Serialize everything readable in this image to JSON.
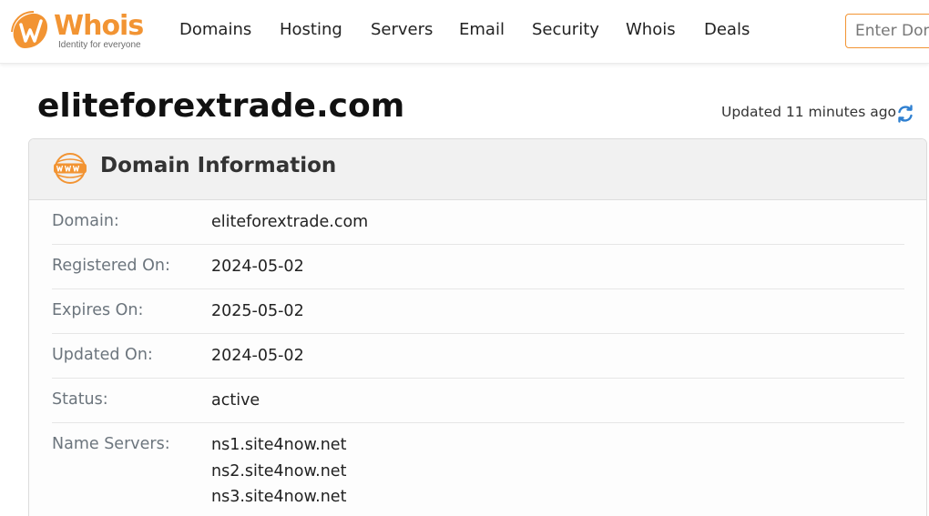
{
  "header": {
    "logo_text": "Whois",
    "logo_tagline": "Identity for everyone",
    "nav": [
      {
        "label": "Domains"
      },
      {
        "label": "Hosting"
      },
      {
        "label": "Servers"
      },
      {
        "label": "Email"
      },
      {
        "label": "Security"
      },
      {
        "label": "Whois"
      },
      {
        "label": "Deals"
      }
    ],
    "search_placeholder": "Enter Domain or IP"
  },
  "page": {
    "title": "eliteforextrade.com",
    "updated_text": "Updated 11 minutes ago"
  },
  "domain_info": {
    "title": "Domain Information",
    "rows": [
      {
        "label": "Domain:",
        "value": "eliteforextrade.com"
      },
      {
        "label": "Registered On:",
        "value": "2024-05-02"
      },
      {
        "label": "Expires On:",
        "value": "2025-05-02"
      },
      {
        "label": "Updated On:",
        "value": "2024-05-02"
      },
      {
        "label": "Status:",
        "value": "active"
      }
    ],
    "name_servers": {
      "label": "Name Servers:",
      "values": [
        "ns1.site4now.net",
        "ns2.site4now.net",
        "ns3.site4now.net"
      ]
    }
  },
  "colors": {
    "brand": "#f29433",
    "refresh": "#2f80d1"
  },
  "icons": {
    "logo": "whois-logo-icon",
    "refresh": "refresh-icon",
    "section": "www-globe-icon"
  }
}
